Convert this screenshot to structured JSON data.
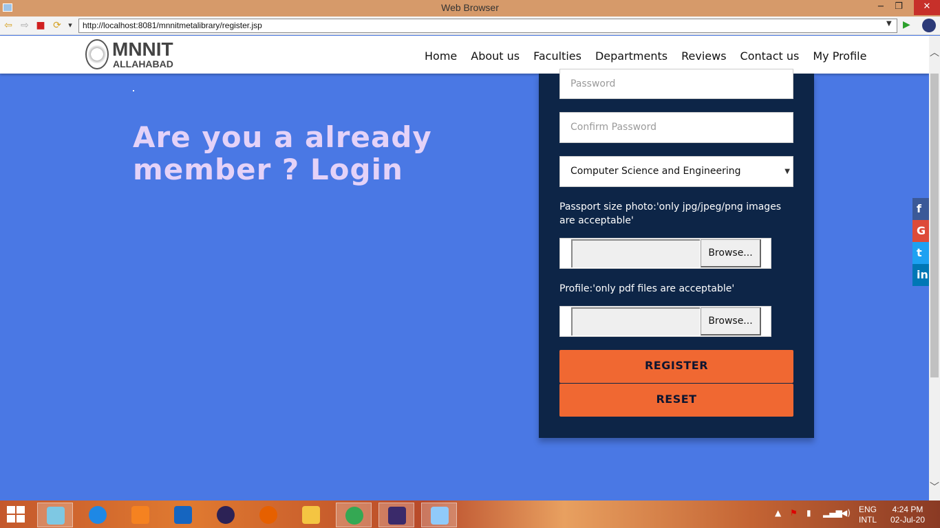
{
  "window": {
    "title": "Web Browser",
    "minimize": "−",
    "maximize": "❐",
    "close": "✕"
  },
  "toolbar": {
    "back": "⇦",
    "forward": "⇨",
    "stop": "■",
    "refresh": "⟳",
    "menu": "▾",
    "url": "http://localhost:8081/mnnitmetalibrary/register.jsp",
    "go": "▶"
  },
  "site": {
    "logo_name": "MNNIT",
    "logo_sub": "ALLAHABAD",
    "nav": [
      "Home",
      "About us",
      "Faculties",
      "Departments",
      "Reviews",
      "Contact us",
      "My Profile"
    ]
  },
  "main": {
    "login_prompt": "Are you a already member ? Login"
  },
  "form": {
    "password_placeholder": "Password",
    "confirm_placeholder": "Confirm Password",
    "department_selected": "Computer Science and Engineering",
    "photo_label": "Passport size photo:'only jpg/jpeg/png images are acceptable'",
    "profile_label": "Profile:'only pdf files are acceptable'",
    "browse_label": "Browse...",
    "register_label": "REGISTER",
    "reset_label": "RESET"
  },
  "social": {
    "facebook": "f",
    "google": "G",
    "twitter": "t",
    "linkedin": "in"
  },
  "taskbar": {
    "lang": "ENG",
    "layout": "INTL",
    "time": "4:24 PM",
    "date": "02-Jul-20",
    "apps": [
      {
        "name": "notepad-icon",
        "color": "#7ec8e3"
      },
      {
        "name": "tools-icon",
        "color": "#1e88e5"
      },
      {
        "name": "pdf-reader-icon",
        "color": "#f58220"
      },
      {
        "name": "defender-icon",
        "color": "#1565c0"
      },
      {
        "name": "eclipse-icon",
        "color": "#2c2255"
      },
      {
        "name": "firefox-icon",
        "color": "#e66000"
      },
      {
        "name": "file-explorer-icon",
        "color": "#f4c542"
      },
      {
        "name": "chrome-icon",
        "color": "#34a853"
      },
      {
        "name": "java-ee-ide-icon",
        "color": "#3a2a6a"
      },
      {
        "name": "paint-icon",
        "color": "#90caf9"
      }
    ]
  },
  "colors": {
    "page_bg": "#4a78e4",
    "panel_bg": "#0d2547",
    "button_accent": "#f06832",
    "heading_text": "#e4d2f8"
  }
}
